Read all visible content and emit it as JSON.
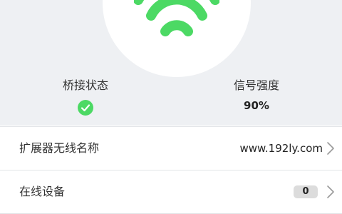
{
  "header": {
    "icon": "wifi-icon",
    "accent_color": "#4cd964"
  },
  "stats": {
    "bridge_status": {
      "label": "桥接状态",
      "icon": "check-circle-icon",
      "state": "connected"
    },
    "signal_strength": {
      "label": "信号强度",
      "value": "90%"
    }
  },
  "rows": [
    {
      "label": "扩展器无线名称",
      "value": "www.192ly.com",
      "icon": "chevron-right-icon"
    },
    {
      "label": "在线设备",
      "badge": "0",
      "icon": "chevron-right-icon"
    }
  ]
}
